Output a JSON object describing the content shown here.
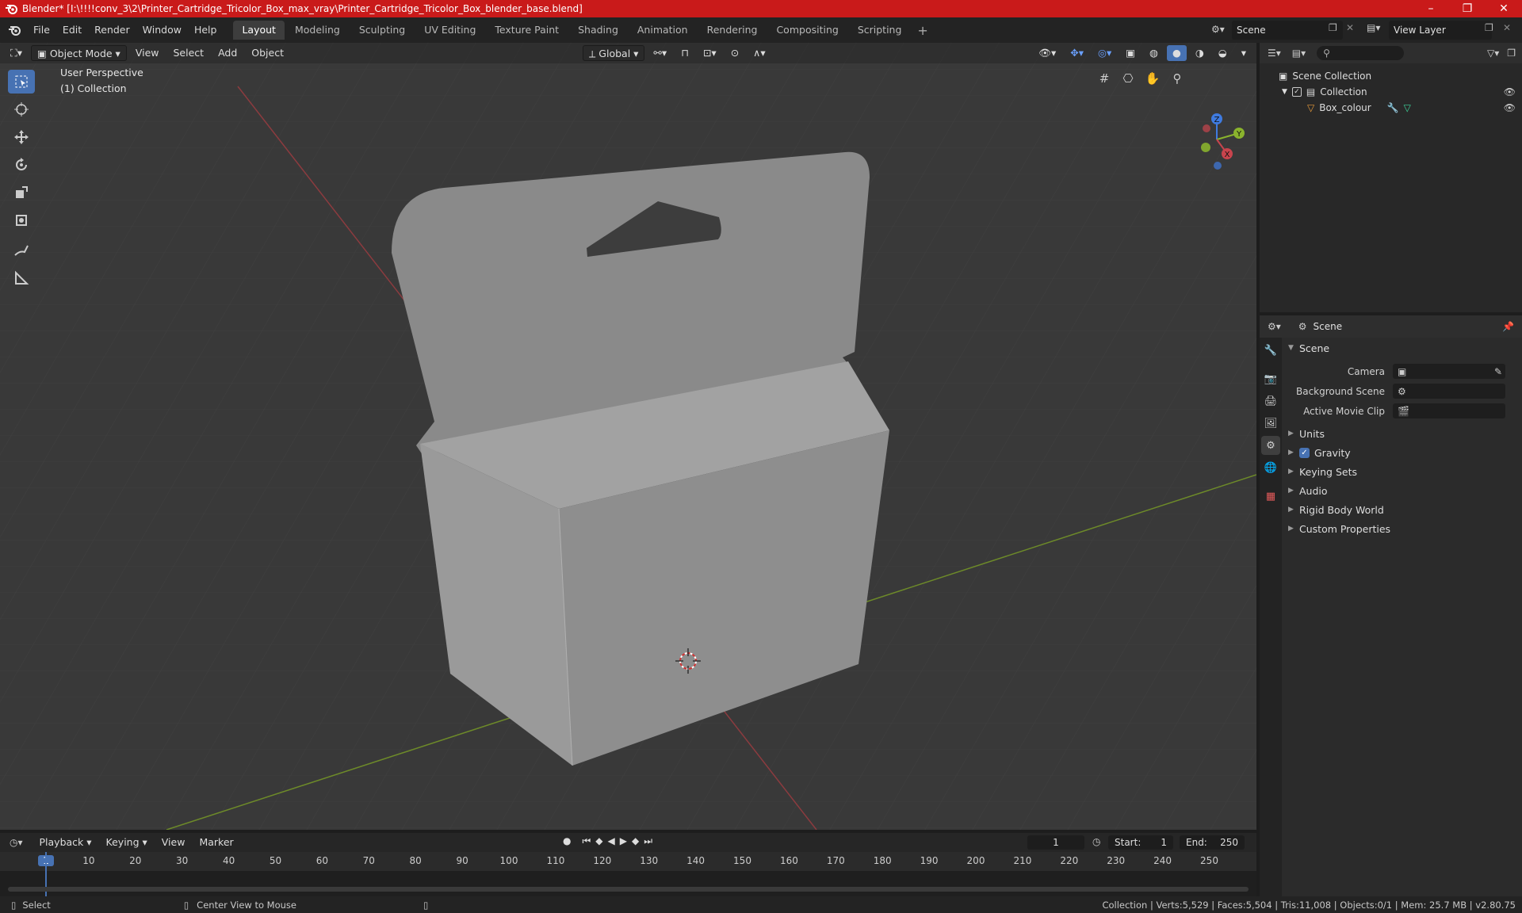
{
  "window": {
    "title": "Blender* [I:\\!!!!conv_3\\2\\Printer_Cartridge_Tricolor_Box_max_vray\\Printer_Cartridge_Tricolor_Box_blender_base.blend]",
    "minimize": "–",
    "maximize": "❐",
    "close": "✕"
  },
  "menu": [
    "File",
    "Edit",
    "Render",
    "Window",
    "Help"
  ],
  "workspaces": [
    "Layout",
    "Modeling",
    "Sculpting",
    "UV Editing",
    "Texture Paint",
    "Shading",
    "Animation",
    "Rendering",
    "Compositing",
    "Scripting"
  ],
  "active_workspace": "Layout",
  "scene_selector": "Scene",
  "view_layer_selector": "View Layer",
  "viewport": {
    "mode": "Object Mode",
    "menus": [
      "View",
      "Select",
      "Add",
      "Object"
    ],
    "orientation": "Global",
    "perspective_label": "User Perspective",
    "collection_label": "(1) Collection",
    "gizmo": {
      "x": "X",
      "y": "Y",
      "z": "Z"
    }
  },
  "tools": [
    "select-box-icon",
    "cursor-icon",
    "move-icon",
    "rotate-icon",
    "scale-icon",
    "transform-icon",
    "annotate-icon",
    "measure-icon"
  ],
  "outliner": {
    "root": "Scene Collection",
    "collection": "Collection",
    "object": "Box_colour"
  },
  "properties": {
    "context": "Scene",
    "panel": "Scene",
    "camera_label": "Camera",
    "background_scene_label": "Background Scene",
    "active_movie_clip_label": "Active Movie Clip",
    "subpanels": {
      "units": "Units",
      "gravity": "Gravity",
      "keying_sets": "Keying Sets",
      "audio": "Audio",
      "rigid_body_world": "Rigid Body World",
      "custom_properties": "Custom Properties"
    }
  },
  "timeline": {
    "menus": [
      "Playback",
      "Keying",
      "View",
      "Marker"
    ],
    "current_frame": "1",
    "start_label": "Start:",
    "start": "1",
    "end_label": "End:",
    "end": "250",
    "ticks": [
      "1",
      "10",
      "20",
      "30",
      "40",
      "50",
      "60",
      "70",
      "80",
      "90",
      "100",
      "110",
      "120",
      "130",
      "140",
      "150",
      "160",
      "170",
      "180",
      "190",
      "200",
      "210",
      "220",
      "230",
      "240",
      "250"
    ]
  },
  "status": {
    "select": "Select",
    "center_view": "Center View to Mouse",
    "stats": "Collection | Verts:5,529 | Faces:5,504 | Tris:11,008 | Objects:0/1 | Mem: 25.7 MB | v2.80.75"
  },
  "colors": {
    "title_bar": "#c91a1a",
    "accent": "#4772b3",
    "x_axis": "#c8444d",
    "y_axis": "#8ab32d",
    "z_axis": "#3f7be0"
  }
}
